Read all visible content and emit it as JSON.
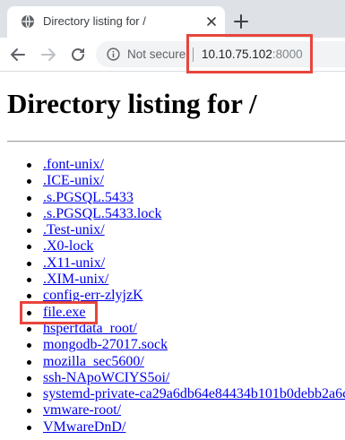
{
  "browser": {
    "tab_title": "Directory listing for /",
    "omnibox": {
      "security_label": "Not secure",
      "url_host": "10.10.75.102",
      "url_port": ":8000"
    }
  },
  "page": {
    "heading": "Directory listing for /",
    "entries": [
      ".font-unix/",
      ".ICE-unix/",
      ".s.PGSQL.5433",
      ".s.PGSQL.5433.lock",
      ".Test-unix/",
      ".X0-lock",
      ".X11-unix/",
      ".XIM-unix/",
      "config-err-zlyjzK",
      "file.exe",
      "hsperfdata_root/",
      "mongodb-27017.sock",
      "mozilla_sec5600/",
      "ssh-NApoWCIYS5oi/",
      "systemd-private-ca29a6db64e84434b101b0debb2a6c",
      "vmware-root/",
      "VMwareDnD/"
    ]
  },
  "annotations": {
    "highlight_color": "#e8453c"
  },
  "icons": [
    "globe-icon",
    "close-icon",
    "plus-icon",
    "arrow-left-icon",
    "arrow-right-icon",
    "reload-icon",
    "info-icon"
  ]
}
